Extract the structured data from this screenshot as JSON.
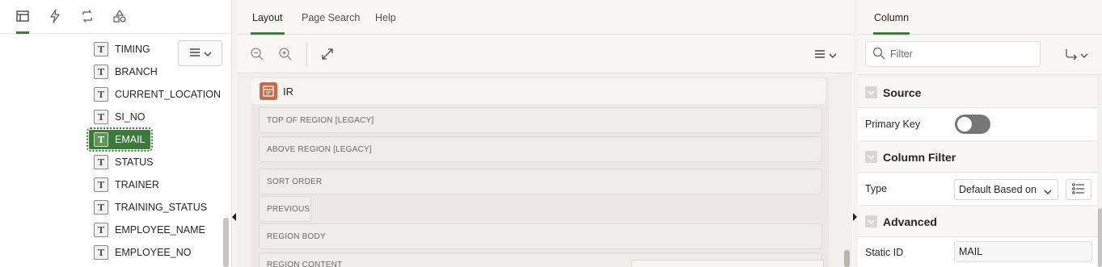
{
  "left_tabs": [
    {
      "name": "rendering-tab",
      "icon": "page-layout-icon",
      "active": true
    },
    {
      "name": "dynamic-actions-tab",
      "icon": "lightning-icon",
      "active": false
    },
    {
      "name": "processing-tab",
      "icon": "refresh-loop-icon",
      "active": false
    },
    {
      "name": "shared-components-tab",
      "icon": "shapes-icon",
      "active": false
    }
  ],
  "tree": {
    "items": [
      {
        "label": "TIMING"
      },
      {
        "label": "BRANCH"
      },
      {
        "label": "CURRENT_LOCATION"
      },
      {
        "label": "SI_NO"
      },
      {
        "label": "EMAIL",
        "selected": true
      },
      {
        "label": "STATUS"
      },
      {
        "label": "TRAINER"
      },
      {
        "label": "TRAINING_STATUS"
      },
      {
        "label": "EMPLOYEE_NAME"
      },
      {
        "label": "EMPLOYEE_NO"
      }
    ],
    "menu_icon": "hamburger-menu-icon"
  },
  "center": {
    "tabs": [
      {
        "label": "Layout",
        "active": true
      },
      {
        "label": "Page Search",
        "active": false
      },
      {
        "label": "Help",
        "active": false
      }
    ],
    "toolbar": {
      "zoom_out_icon": "zoom-out-icon",
      "zoom_in_icon": "zoom-in-icon",
      "expand_icon": "expand-icon",
      "menu_icon": "hamburger-menu-icon"
    },
    "region": {
      "title": "IR",
      "icon": "interactive-report-icon",
      "slots": [
        "TOP OF REGION [LEGACY]",
        "ABOVE REGION [LEGACY]",
        "SORT ORDER",
        "PREVIOUS",
        "REGION BODY",
        "REGION CONTENT"
      ]
    }
  },
  "right": {
    "tab": "Column",
    "filter_placeholder": "Filter",
    "groups": {
      "source": {
        "title": "Source",
        "primary_key_label": "Primary Key",
        "primary_key_on": false
      },
      "column_filter": {
        "title": "Column Filter",
        "type_label": "Type",
        "type_value": "Default Based on"
      },
      "advanced": {
        "title": "Advanced",
        "static_id_label": "Static ID",
        "static_id_value": "MAIL"
      }
    }
  },
  "colors": {
    "accent": "#3d7d3a",
    "selected_bg": "#3c7a3a",
    "region_icon": "#c46a4d"
  }
}
